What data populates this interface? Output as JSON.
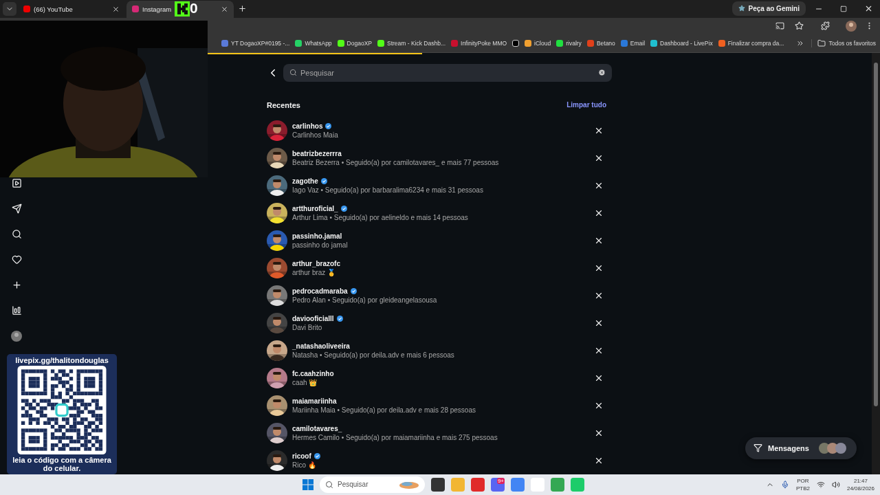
{
  "browser": {
    "tabs": [
      {
        "title": "(66) YouTube",
        "selected": false
      },
      {
        "title": "Instagram",
        "selected": true
      }
    ],
    "tab_overlay_count": "0",
    "gemini_button": "Peça ao Gemini",
    "bookmarks": [
      {
        "label": "YT DogaoXP#0195 -..."
      },
      {
        "label": "WhatsApp"
      },
      {
        "label": "DogaoXP"
      },
      {
        "label": "Stream - Kick Dashb..."
      },
      {
        "label": "InfinityPoke MMO"
      },
      {
        "kind": "icon"
      },
      {
        "label": "iCloud"
      },
      {
        "label": "rivalry"
      },
      {
        "label": "Betano"
      },
      {
        "label": "Email"
      },
      {
        "label": "Dashboard - LivePix"
      },
      {
        "label": "Finalizar compra da..."
      }
    ],
    "all_bookmarks": "Todos os favoritos"
  },
  "loading_bar": {
    "level": 0.48
  },
  "search": {
    "placeholder": "Pesquisar"
  },
  "recent": {
    "title": "Recentes",
    "clear_link": "Limpar tudo",
    "items": [
      {
        "username": "carlinhos",
        "verified": true,
        "subtitle": "Carlinhos Maia"
      },
      {
        "username": "beatrizbezerrra",
        "verified": false,
        "subtitle": "Beatriz Bezerra • Seguido(a) por camilotavares_ e mais 77 pessoas"
      },
      {
        "username": "zagothe",
        "verified": true,
        "subtitle": "Iago Vaz • Seguido(a) por barbaralima6234 e mais 31 pessoas"
      },
      {
        "username": "artthuroficial_",
        "verified": true,
        "subtitle": "Arthur Lima • Seguido(a) por aelineldo e mais 14 pessoas"
      },
      {
        "username": "passinho.jamal",
        "verified": false,
        "subtitle": "passinho do jamal"
      },
      {
        "username": "arthur_brazofc",
        "verified": false,
        "subtitle": "arthur braz 🥇"
      },
      {
        "username": "pedrocadmaraba",
        "verified": true,
        "subtitle": "Pedro Alan • Seguido(a) por gleideangelasousa"
      },
      {
        "username": "daviooficialll",
        "verified": true,
        "subtitle": "Davi Brito"
      },
      {
        "username": "_natashaoliveeira",
        "verified": false,
        "subtitle": "Natasha • Seguido(a) por deila.adv e mais 6 pessoas"
      },
      {
        "username": "fc.caahzinho",
        "verified": false,
        "subtitle": "caah 👑"
      },
      {
        "username": "maiamariinha",
        "verified": false,
        "subtitle": "Mariinha Maia • Seguido(a) por deila.adv e mais 28 pessoas"
      },
      {
        "username": "camilotavares_",
        "verified": false,
        "subtitle": "Hermes Camilo • Seguido(a) por maiamariinha e mais 275 pessoas"
      },
      {
        "username": "ricoof",
        "verified": true,
        "subtitle": "Rico 🔥"
      }
    ]
  },
  "messages_button": "Mensagens",
  "qr_overlay": {
    "url": "livepix.gg/thalitondouglas",
    "caption": "leia o código com a câmera do celular."
  },
  "taskbar": {
    "search_placeholder": "Pesquisar",
    "discord_badge": "9+",
    "language": "POR",
    "layout": "PTB2",
    "time": "21:47",
    "date": "24/08/2026"
  }
}
